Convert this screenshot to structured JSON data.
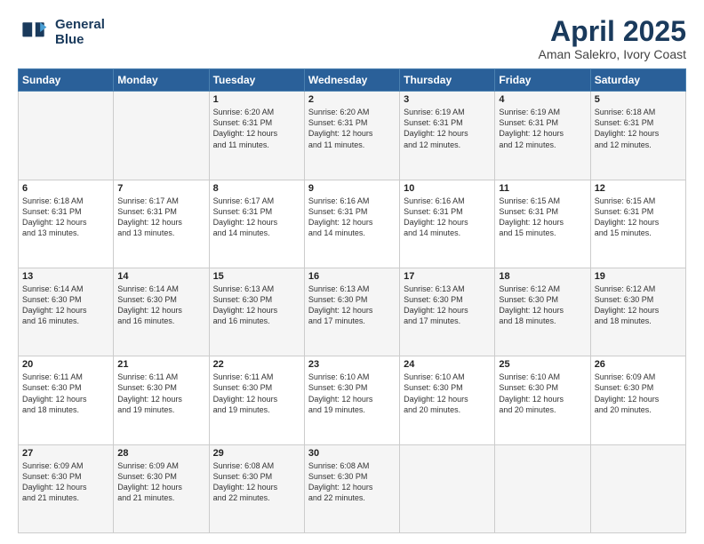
{
  "header": {
    "logo_line1": "General",
    "logo_line2": "Blue",
    "title": "April 2025",
    "subtitle": "Aman Salekro, Ivory Coast"
  },
  "days_of_week": [
    "Sunday",
    "Monday",
    "Tuesday",
    "Wednesday",
    "Thursday",
    "Friday",
    "Saturday"
  ],
  "weeks": [
    [
      {
        "day": "",
        "info": ""
      },
      {
        "day": "",
        "info": ""
      },
      {
        "day": "1",
        "info": "Sunrise: 6:20 AM\nSunset: 6:31 PM\nDaylight: 12 hours\nand 11 minutes."
      },
      {
        "day": "2",
        "info": "Sunrise: 6:20 AM\nSunset: 6:31 PM\nDaylight: 12 hours\nand 11 minutes."
      },
      {
        "day": "3",
        "info": "Sunrise: 6:19 AM\nSunset: 6:31 PM\nDaylight: 12 hours\nand 12 minutes."
      },
      {
        "day": "4",
        "info": "Sunrise: 6:19 AM\nSunset: 6:31 PM\nDaylight: 12 hours\nand 12 minutes."
      },
      {
        "day": "5",
        "info": "Sunrise: 6:18 AM\nSunset: 6:31 PM\nDaylight: 12 hours\nand 12 minutes."
      }
    ],
    [
      {
        "day": "6",
        "info": "Sunrise: 6:18 AM\nSunset: 6:31 PM\nDaylight: 12 hours\nand 13 minutes."
      },
      {
        "day": "7",
        "info": "Sunrise: 6:17 AM\nSunset: 6:31 PM\nDaylight: 12 hours\nand 13 minutes."
      },
      {
        "day": "8",
        "info": "Sunrise: 6:17 AM\nSunset: 6:31 PM\nDaylight: 12 hours\nand 14 minutes."
      },
      {
        "day": "9",
        "info": "Sunrise: 6:16 AM\nSunset: 6:31 PM\nDaylight: 12 hours\nand 14 minutes."
      },
      {
        "day": "10",
        "info": "Sunrise: 6:16 AM\nSunset: 6:31 PM\nDaylight: 12 hours\nand 14 minutes."
      },
      {
        "day": "11",
        "info": "Sunrise: 6:15 AM\nSunset: 6:31 PM\nDaylight: 12 hours\nand 15 minutes."
      },
      {
        "day": "12",
        "info": "Sunrise: 6:15 AM\nSunset: 6:31 PM\nDaylight: 12 hours\nand 15 minutes."
      }
    ],
    [
      {
        "day": "13",
        "info": "Sunrise: 6:14 AM\nSunset: 6:30 PM\nDaylight: 12 hours\nand 16 minutes."
      },
      {
        "day": "14",
        "info": "Sunrise: 6:14 AM\nSunset: 6:30 PM\nDaylight: 12 hours\nand 16 minutes."
      },
      {
        "day": "15",
        "info": "Sunrise: 6:13 AM\nSunset: 6:30 PM\nDaylight: 12 hours\nand 16 minutes."
      },
      {
        "day": "16",
        "info": "Sunrise: 6:13 AM\nSunset: 6:30 PM\nDaylight: 12 hours\nand 17 minutes."
      },
      {
        "day": "17",
        "info": "Sunrise: 6:13 AM\nSunset: 6:30 PM\nDaylight: 12 hours\nand 17 minutes."
      },
      {
        "day": "18",
        "info": "Sunrise: 6:12 AM\nSunset: 6:30 PM\nDaylight: 12 hours\nand 18 minutes."
      },
      {
        "day": "19",
        "info": "Sunrise: 6:12 AM\nSunset: 6:30 PM\nDaylight: 12 hours\nand 18 minutes."
      }
    ],
    [
      {
        "day": "20",
        "info": "Sunrise: 6:11 AM\nSunset: 6:30 PM\nDaylight: 12 hours\nand 18 minutes."
      },
      {
        "day": "21",
        "info": "Sunrise: 6:11 AM\nSunset: 6:30 PM\nDaylight: 12 hours\nand 19 minutes."
      },
      {
        "day": "22",
        "info": "Sunrise: 6:11 AM\nSunset: 6:30 PM\nDaylight: 12 hours\nand 19 minutes."
      },
      {
        "day": "23",
        "info": "Sunrise: 6:10 AM\nSunset: 6:30 PM\nDaylight: 12 hours\nand 19 minutes."
      },
      {
        "day": "24",
        "info": "Sunrise: 6:10 AM\nSunset: 6:30 PM\nDaylight: 12 hours\nand 20 minutes."
      },
      {
        "day": "25",
        "info": "Sunrise: 6:10 AM\nSunset: 6:30 PM\nDaylight: 12 hours\nand 20 minutes."
      },
      {
        "day": "26",
        "info": "Sunrise: 6:09 AM\nSunset: 6:30 PM\nDaylight: 12 hours\nand 20 minutes."
      }
    ],
    [
      {
        "day": "27",
        "info": "Sunrise: 6:09 AM\nSunset: 6:30 PM\nDaylight: 12 hours\nand 21 minutes."
      },
      {
        "day": "28",
        "info": "Sunrise: 6:09 AM\nSunset: 6:30 PM\nDaylight: 12 hours\nand 21 minutes."
      },
      {
        "day": "29",
        "info": "Sunrise: 6:08 AM\nSunset: 6:30 PM\nDaylight: 12 hours\nand 22 minutes."
      },
      {
        "day": "30",
        "info": "Sunrise: 6:08 AM\nSunset: 6:30 PM\nDaylight: 12 hours\nand 22 minutes."
      },
      {
        "day": "",
        "info": ""
      },
      {
        "day": "",
        "info": ""
      },
      {
        "day": "",
        "info": ""
      }
    ]
  ]
}
